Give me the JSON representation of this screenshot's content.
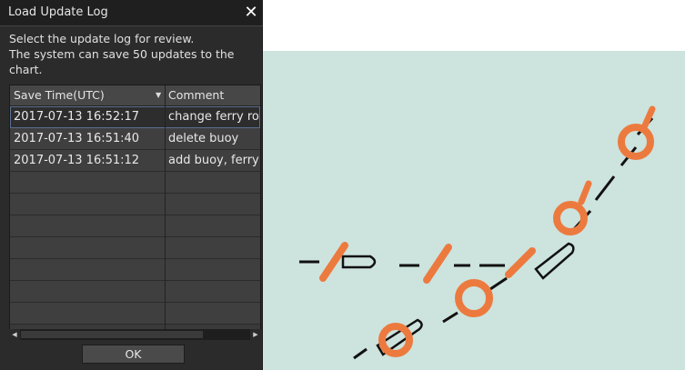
{
  "dialog": {
    "title": "Load Update Log",
    "description_lines": [
      "Select the update log for review.",
      "The system can save 50 updates to the",
      "chart."
    ],
    "columns": {
      "time": "Save Time(UTC)",
      "comment": "Comment"
    },
    "rows": [
      {
        "time": "2017-07-13 16:52:17",
        "comment": "change ferry route"
      },
      {
        "time": "2017-07-13 16:51:40",
        "comment": "delete buoy"
      },
      {
        "time": "2017-07-13 16:51:12",
        "comment": "add buoy, ferry route"
      }
    ],
    "ok_label": "OK"
  },
  "colors": {
    "chart_background": "#cde3dd",
    "symbol_orange": "#ec7a3f",
    "route_line": "#111111"
  }
}
